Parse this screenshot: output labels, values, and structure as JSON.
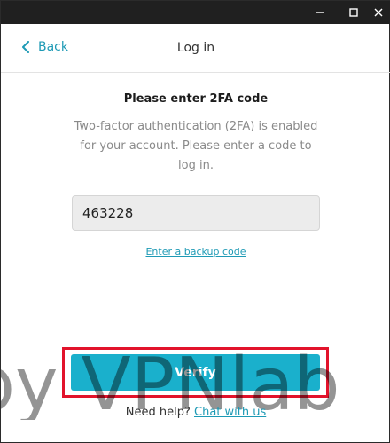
{
  "header": {
    "back_label": "Back",
    "title": "Log in"
  },
  "main": {
    "heading": "Please enter 2FA code",
    "description": "Two-factor authentication (2FA) is enabled for your account. Please enter a code to log in.",
    "code_value": "463228",
    "backup_link": "Enter a backup code",
    "verify_label": "Verify"
  },
  "footer": {
    "help_text": "Need help?",
    "help_link": "Chat with us"
  },
  "watermark": {
    "text": "by VPNlab"
  },
  "colors": {
    "accent": "#1e9ab5",
    "button": "#1ab0cc",
    "highlight": "#e2132b",
    "titlebar": "#202020"
  },
  "icons": {
    "minimize": "minimize-icon",
    "maximize": "maximize-icon",
    "close": "close-icon",
    "back": "chevron-left-icon"
  }
}
